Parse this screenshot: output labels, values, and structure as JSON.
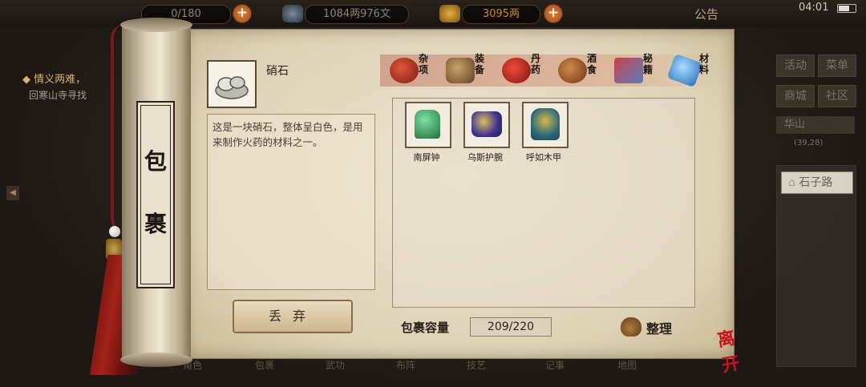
{
  "hud": {
    "bag_counter": "0/180",
    "copper": "1084两976文",
    "silver": "3095两",
    "notice": "公告",
    "clock": "04:01"
  },
  "quest": {
    "title": "◆ 情义两难，",
    "detail": "回寒山寺寻找"
  },
  "right_panel": {
    "buttons": [
      "活动",
      "菜单",
      "商城",
      "社区"
    ],
    "location": "华山",
    "coords": "(39,28)",
    "road": "石子路"
  },
  "scroll": {
    "title_chars": [
      "包",
      "裹"
    ]
  },
  "selected_item": {
    "name": "硝石",
    "description": "这是一块硝石，整体呈白色，是用来制作火药的材料之一。"
  },
  "discard_button": "丢弃",
  "tabs": [
    {
      "label": "杂项",
      "icon": "pot-icon",
      "color": "#b53a22"
    },
    {
      "label": "装备",
      "icon": "scroll-weapon-icon",
      "color": "#8a6c3e"
    },
    {
      "label": "丹药",
      "icon": "pill-icon",
      "color": "#c22b2b"
    },
    {
      "label": "酒食",
      "icon": "wine-jar-icon",
      "color": "#9a5a2a"
    },
    {
      "label": "秘籍",
      "icon": "book-icon",
      "color": "#a33a3a"
    },
    {
      "label": "材料",
      "icon": "crystal-icon",
      "color": "#3b8fd6"
    }
  ],
  "items": [
    {
      "name": "南屏钟",
      "icon": "bell-icon",
      "color": "#2f9a5a"
    },
    {
      "name": "乌斯护腕",
      "icon": "bracer-icon",
      "color": "#5a4aa8"
    },
    {
      "name": "呼如木甲",
      "icon": "armor-icon",
      "color": "#3a7a8a"
    }
  ],
  "capacity": {
    "label": "包裹容量",
    "value": "209/220"
  },
  "sort_button": "整理",
  "bottom_menu": [
    "角色",
    "包裹",
    "武功",
    "布阵",
    "技艺",
    "记事",
    "地图"
  ],
  "seal": "离开"
}
